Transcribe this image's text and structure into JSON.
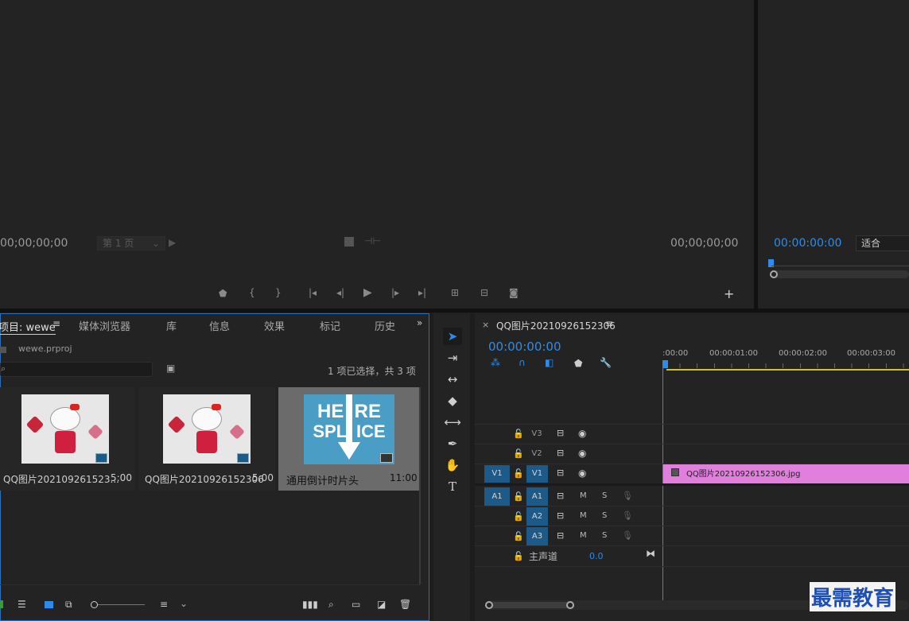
{
  "source_monitor": {
    "timecode_in": "00;00;00;00",
    "page_selector": "第 1 页",
    "timecode_out": "00;00;00;00"
  },
  "program_monitor": {
    "timecode": "00:00:00:00",
    "fit": "适合"
  },
  "project_panel": {
    "tabs": [
      "项目: wewe",
      "媒体浏览器",
      "库",
      "信息",
      "效果",
      "标记",
      "历史"
    ],
    "project_file": "wewe.prproj",
    "search_placeholder": "",
    "selection_status": "1 项已选择，共 3 项",
    "items": [
      {
        "name": "QQ图片202109261523...",
        "duration": "5:00"
      },
      {
        "name": "QQ图片20210926152306",
        "duration": "5:00"
      },
      {
        "name": "通用倒计时片头",
        "duration": "11:00"
      }
    ],
    "splice_text_top": "HE  RE",
    "splice_text_bottom": "SPL  ICE"
  },
  "timeline": {
    "sequence_name": "QQ图片20210926152306",
    "timecode": "00:00:00:00",
    "ruler_labels": [
      ":00:00",
      "00:00:01:00",
      "00:00:02:00",
      "00:00:03:00"
    ],
    "tracks": {
      "v3": "V3",
      "v2": "V2",
      "v1_src": "V1",
      "v1": "V1",
      "a1_src": "A1",
      "a1": "A1",
      "a2": "A2",
      "a3": "A3",
      "mute": "M",
      "solo": "S",
      "master": "主声道",
      "master_value": "0.0"
    },
    "clip_name": "QQ图片20210926152306.jpg",
    "clip_color": "#e07fdc"
  },
  "watermark": "最需教育",
  "colors": {
    "accent_blue": "#2d8ceb",
    "selected_track": "#1d5a88",
    "playhead_yellow": "#d4c21a"
  }
}
